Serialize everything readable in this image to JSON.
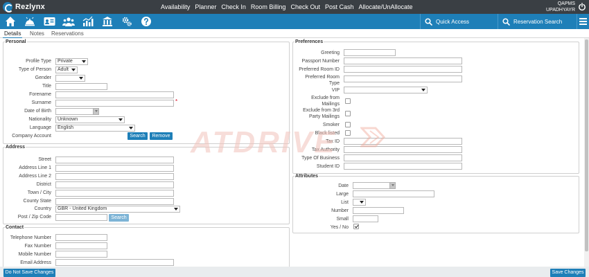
{
  "app": {
    "name": "Rezlynx"
  },
  "nav": [
    "Availability",
    "Planner",
    "Check In",
    "Room Billing",
    "Check Out",
    "Post Cash",
    "Allocate/UnAllocate"
  ],
  "user": {
    "line1": "QAPMS",
    "line2": "UPADHYAYR"
  },
  "toolbar": {
    "quick_access": "Quick Access",
    "reservation_search": "Reservation Search"
  },
  "tabs": [
    "Details",
    "Notes",
    "Reservations"
  ],
  "watermark": "ATDRIVE",
  "personal": {
    "legend": "Personal",
    "labels": {
      "profile_type": "Profile Type",
      "type_of_person": "Type of Person",
      "gender": "Gender",
      "title": "Title",
      "forename": "Forename",
      "surname": "Surname",
      "dob": "Date of Birth",
      "nationality": "Nationality",
      "language": "Language",
      "company_account": "Company Account"
    },
    "values": {
      "profile_type": "Private",
      "type_of_person": "Adult",
      "gender": "",
      "nationality": "Unknown",
      "language": "English"
    },
    "required_mark": "*",
    "search": "Search",
    "remove": "Remove"
  },
  "address": {
    "legend": "Address",
    "labels": {
      "street": "Street",
      "line1": "Address Line 1",
      "line2": "Address Line 2",
      "district": "District",
      "town": "Town / City",
      "county": "County State",
      "country": "Country",
      "postcode": "Post / Zip Code"
    },
    "values": {
      "country": "GBR - United Kingdom"
    },
    "search": "Search"
  },
  "contact": {
    "legend": "Contact",
    "labels": {
      "telephone": "Telephone Number",
      "fax": "Fax Number",
      "mobile": "Mobile Number",
      "email": "Email Address"
    }
  },
  "preferences": {
    "legend": "Preferences",
    "labels": {
      "greeting": "Greeting",
      "passport": "Passport Number",
      "pref_room_id": "Preferred Room ID",
      "pref_room_type_1": "Preferred Room",
      "pref_room_type_2": "Type",
      "vip": "VIP",
      "excl_mail_1": "Exclude from",
      "excl_mail_2": "Mailings",
      "excl_3rd_1": "Exclude from 3rd",
      "excl_3rd_2": "Party Mailings",
      "smoker": "Smoker",
      "blacklisted": "Black listed",
      "tax_id": "Tax ID",
      "tax_authority": "Tax Authority",
      "type_of_business": "Type Of Business",
      "student_id": "Student ID"
    }
  },
  "attributes": {
    "legend": "Attributes",
    "labels": {
      "date": "Date",
      "large": "Large",
      "list": "List",
      "number": "Number",
      "small": "Small",
      "yesno": "Yes / No"
    }
  },
  "footer": {
    "dont_save": "Do Not Save Changes",
    "save": "Save Changes"
  }
}
